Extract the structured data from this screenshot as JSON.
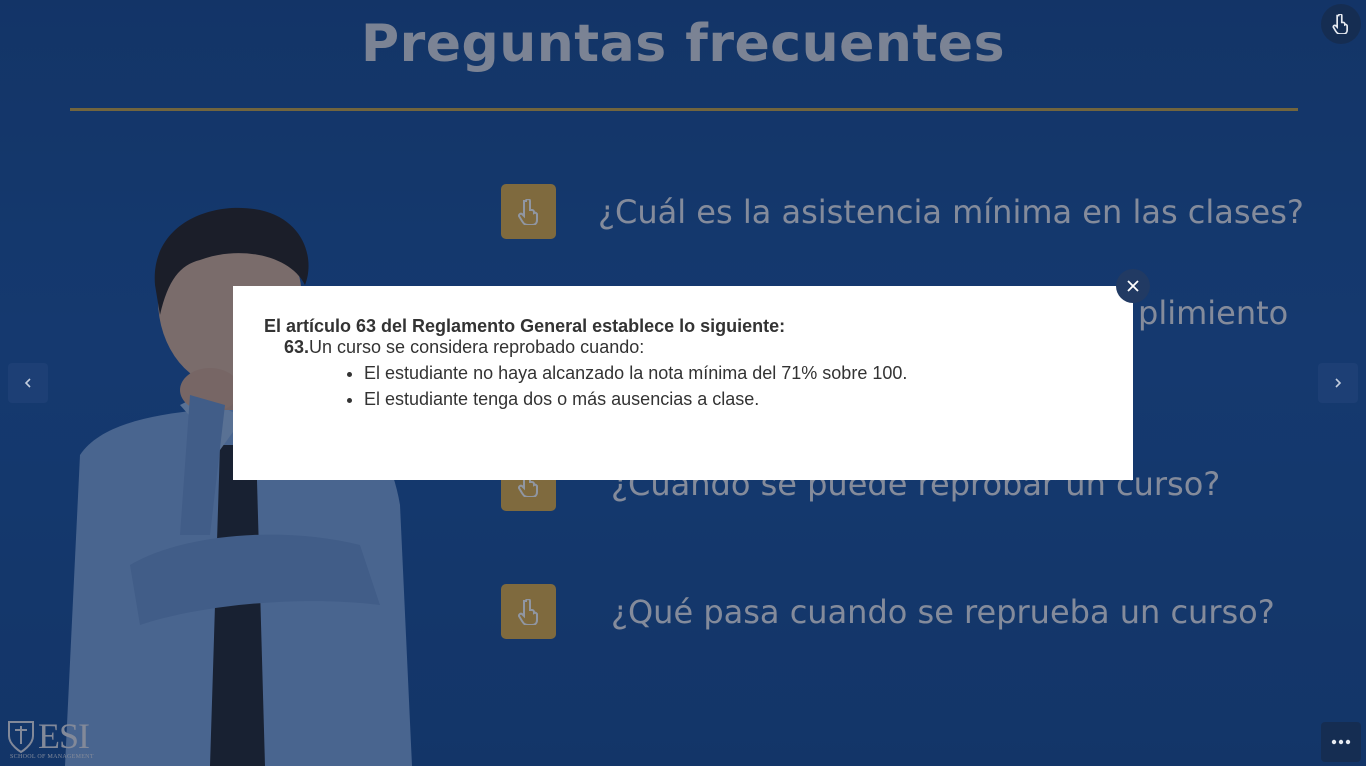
{
  "slide": {
    "title": "Preguntas frecuentes",
    "questions": [
      {
        "text": "¿Cuál es la asistencia mínima en las clases?"
      },
      {
        "text": "plimiento"
      },
      {
        "text": "¿Cuándo se puede reprobar un curso?"
      },
      {
        "text": "¿Qué pasa cuando se reprueba un curso?"
      }
    ],
    "logo": {
      "text": "ESI",
      "subtitle": "SCHOOL OF MANAGEMENT"
    }
  },
  "modal": {
    "heading": "El artículo 63 del Reglamento General establece lo siguiente:",
    "article_number": "63.",
    "article_text": "Un curso se considera reprobado cuando:",
    "items": [
      "El estudiante no haya alcanzado la nota mínima del 71% sobre 100.",
      "El estudiante tenga dos o más ausencias a clase."
    ]
  },
  "colors": {
    "background": "#1f57a3",
    "accent_gold": "#e0b04a",
    "title_rule": "#c9a74a",
    "close_button": "#213a63"
  },
  "icons": {
    "question_button": "hand-pointer-icon",
    "top_right": "hand-pointer-icon",
    "prev": "chevron-left-icon",
    "next": "chevron-right-icon",
    "menu": "more-horizontal-icon",
    "close": "close-icon"
  }
}
